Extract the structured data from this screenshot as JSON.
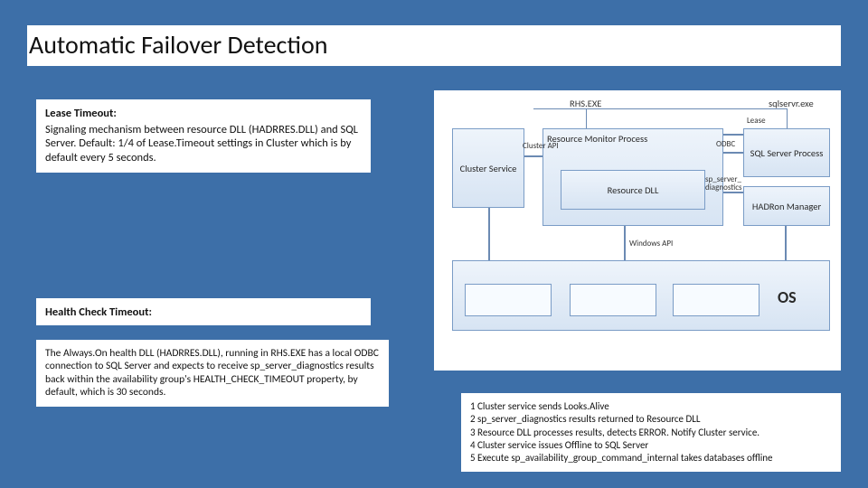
{
  "title": "Automatic Failover Detection",
  "lease": {
    "heading": "Lease Timeout:",
    "body": "Signaling mechanism between resource DLL (HADRRES.DLL) and SQL Server. Default: 1/4 of Lease.Timeout settings in Cluster which is by default every 5 seconds."
  },
  "health": {
    "heading": "Health Check Timeout:",
    "body": "The Always.On health DLL (HADRRES.DLL), running in RHS.EXE has a local ODBC connection to SQL Server and expects to receive sp_server_diagnostics results back within the availability group's HEALTH_CHECK_TIMEOUT property, by default, which is 30 seconds."
  },
  "flow": [
    "1 Cluster service sends Looks.Alive",
    "2 sp_server_diagnostics results returned to Resource DLL",
    "3 Resource DLL processes results, detects ERROR. Notify Cluster service.",
    "4 Cluster service issues Offline to SQL Server",
    "5 Execute sp_availability_group_command_internal takes databases offline"
  ],
  "diagram": {
    "rhs_label": "RHS.EXE",
    "sqlservr_label": "sqlservr.exe",
    "lease_label": "Lease",
    "cluster_api_label": "Cluster API",
    "odbc_label": "ODBC",
    "sp_diag_label": "sp_server_\ndiagnostics",
    "windows_api_label": "Windows API",
    "cluster_service": "Cluster Service",
    "resource_monitor": "Resource Monitor Process",
    "resource_dll": "Resource DLL",
    "sql_server_process": "SQL Server Process",
    "hadron_manager": "HADRon Manager",
    "os_label": "OS"
  }
}
